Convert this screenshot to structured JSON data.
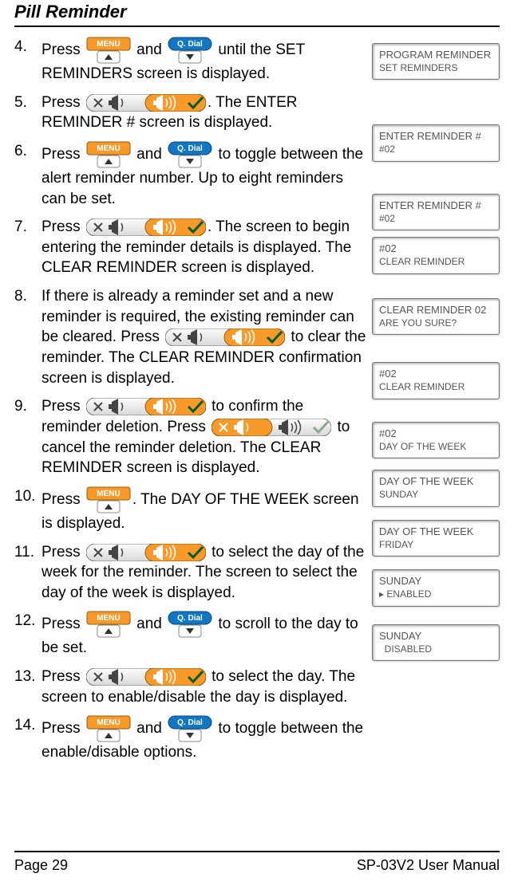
{
  "header": {
    "title": "Pill Reminder"
  },
  "buttons": {
    "menu_label": "MENU",
    "qdial_label": "Q. Dial"
  },
  "steps": [
    {
      "parts": [
        "Press ",
        "@menu",
        " and ",
        "@qdial",
        " until the SET REMINDERS screen is displayed."
      ]
    },
    {
      "parts": [
        "Press ",
        "@vol",
        ". The ENTER REMINDER # screen is displayed."
      ]
    },
    {
      "parts": [
        "Press ",
        "@menu",
        " and ",
        "@qdial",
        " to toggle between the alert reminder number. Up to eight reminders can be set."
      ]
    },
    {
      "parts": [
        "Press ",
        "@vol",
        ". The screen to begin entering the reminder details is displayed. The CLEAR REMINDER screen is displayed."
      ]
    },
    {
      "parts": [
        "If there is already a reminder set and a new reminder is required, the existing reminder can be cleared. Press ",
        "@vol",
        " to clear the reminder. The CLEAR REMINDER confirmation screen is displayed."
      ]
    },
    {
      "parts": [
        "Press ",
        "@vol",
        " to confirm the reminder deletion. Press ",
        "@volmute",
        " to cancel the reminder deletion. The CLEAR REMINDER screen is displayed."
      ]
    },
    {
      "parts": [
        "Press ",
        "@menu",
        ". The DAY OF THE WEEK screen is displayed."
      ]
    },
    {
      "parts": [
        "Press ",
        "@vol",
        " to select the day of the week for the reminder. The screen to select the day of the week is displayed."
      ]
    },
    {
      "parts": [
        "Press ",
        "@menu",
        " and ",
        "@qdial",
        " to scroll to the day to be set."
      ]
    },
    {
      "parts": [
        "Press ",
        "@vol",
        " to select the day. The screen to enable/disable the day is displayed."
      ]
    },
    {
      "parts": [
        "Press ",
        "@menu",
        " and ",
        "@qdial",
        " to toggle between the enable/disable options."
      ]
    }
  ],
  "screens": [
    {
      "line1": "PROGRAM REMINDER",
      "line2": "SET REMINDERS"
    },
    {
      "line1": "ENTER REMINDER #",
      "line2": "#02"
    },
    {
      "line1": "ENTER REMINDER #",
      "line2": "#02"
    },
    {
      "line1": "#02",
      "line2": "CLEAR REMINDER"
    },
    {
      "line1": "CLEAR REMINDER 02",
      "line2": "ARE YOU SURE?"
    },
    {
      "line1": "#02",
      "line2": "CLEAR REMINDER"
    },
    {
      "line1": "#02",
      "line2": "DAY OF THE WEEK"
    },
    {
      "line1": "DAY OF THE WEEK",
      "line2": "SUNDAY"
    },
    {
      "line1": "DAY OF THE WEEK",
      "line2": "FRIDAY"
    },
    {
      "line1": "SUNDAY",
      "line2": "▸ ENABLED"
    },
    {
      "line1": "SUNDAY",
      "line2": "  DISABLED"
    }
  ],
  "footer": {
    "page": "Page 29",
    "manual": "SP-03V2 User Manual"
  }
}
